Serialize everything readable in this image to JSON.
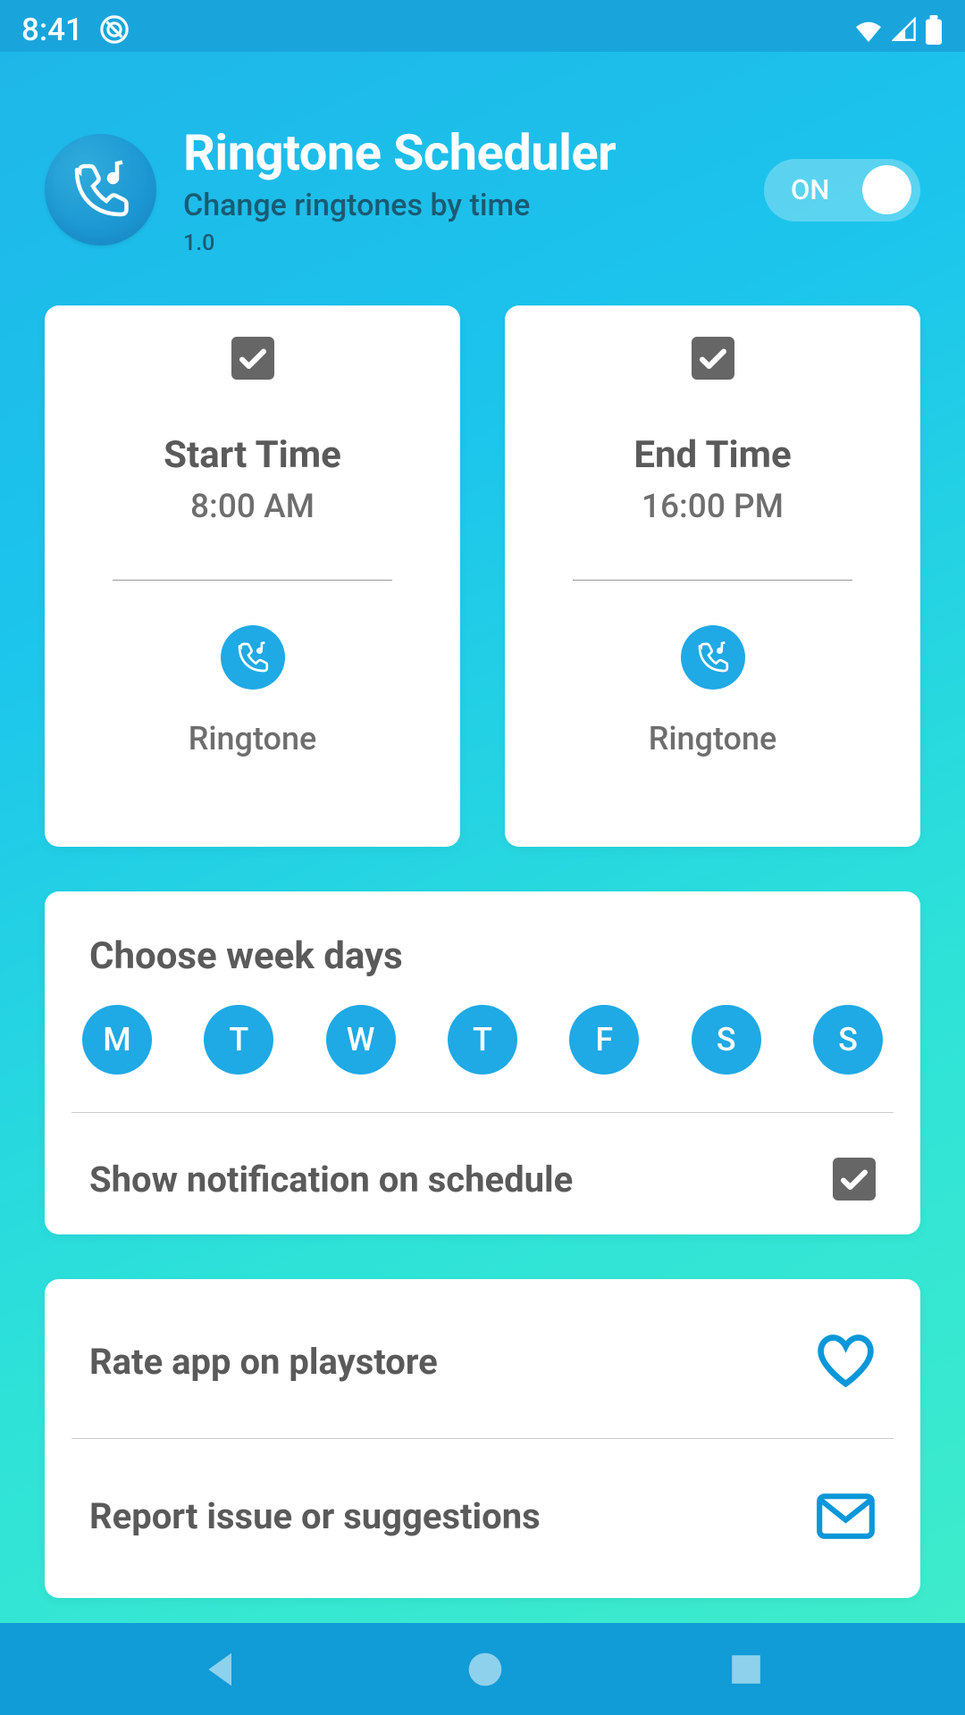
{
  "status_bar": {
    "time": "8:41"
  },
  "header": {
    "title": "Ringtone Scheduler",
    "subtitle": "Change ringtones by time",
    "version": "1.0",
    "toggle_label": "ON"
  },
  "start_card": {
    "label": "Start Time",
    "value": "8:00 AM",
    "ringtone_label": "Ringtone"
  },
  "end_card": {
    "label": "End Time",
    "value": "16:00 PM",
    "ringtone_label": "Ringtone"
  },
  "weekdays": {
    "title": "Choose week days",
    "days": [
      "M",
      "T",
      "W",
      "T",
      "F",
      "S",
      "S"
    ]
  },
  "notification": {
    "label": "Show notification on schedule"
  },
  "actions": {
    "rate": "Rate app on playstore",
    "report": "Report issue or suggestions"
  }
}
